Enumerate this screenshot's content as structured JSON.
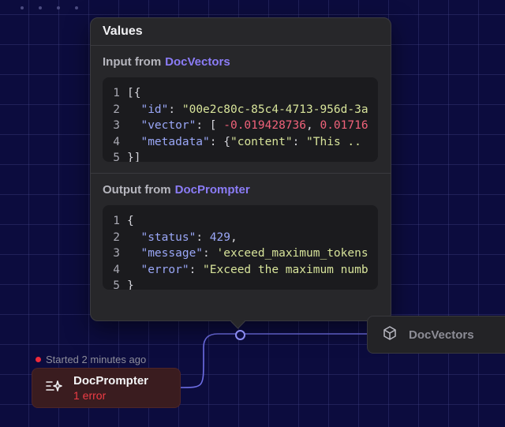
{
  "popover": {
    "title": "Values",
    "input": {
      "prefix": "Input from",
      "source": "DocVectors",
      "lines": [
        {
          "no": "1",
          "parts": [
            {
              "t": "p",
              "v": "[{"
            }
          ]
        },
        {
          "no": "2",
          "parts": [
            {
              "t": "p",
              "v": "  "
            },
            {
              "t": "k",
              "v": "\"id\""
            },
            {
              "t": "p",
              "v": ": "
            },
            {
              "t": "s",
              "v": "\"00e2c80c-85c4-4713-956d-3a"
            }
          ]
        },
        {
          "no": "3",
          "parts": [
            {
              "t": "p",
              "v": "  "
            },
            {
              "t": "k",
              "v": "\"vector\""
            },
            {
              "t": "p",
              "v": ": [ "
            },
            {
              "t": "n",
              "v": "-0.019428736"
            },
            {
              "t": "p",
              "v": ", "
            },
            {
              "t": "n",
              "v": "0.01716"
            }
          ]
        },
        {
          "no": "4",
          "parts": [
            {
              "t": "p",
              "v": "  "
            },
            {
              "t": "k",
              "v": "\"metadata\""
            },
            {
              "t": "p",
              "v": ": {"
            },
            {
              "t": "s",
              "v": "\"content\""
            },
            {
              "t": "p",
              "v": ": "
            },
            {
              "t": "s",
              "v": "\"This .."
            }
          ]
        },
        {
          "no": "5",
          "parts": [
            {
              "t": "p",
              "v": "}]"
            }
          ]
        }
      ]
    },
    "output": {
      "prefix": "Output from",
      "source": "DocPrompter",
      "lines": [
        {
          "no": "1",
          "parts": [
            {
              "t": "p",
              "v": "{"
            }
          ]
        },
        {
          "no": "2",
          "parts": [
            {
              "t": "p",
              "v": "  "
            },
            {
              "t": "k",
              "v": "\"status\""
            },
            {
              "t": "p",
              "v": ": "
            },
            {
              "t": "k",
              "v": "429"
            },
            {
              "t": "p",
              "v": ","
            }
          ]
        },
        {
          "no": "3",
          "parts": [
            {
              "t": "p",
              "v": "  "
            },
            {
              "t": "k",
              "v": "\"message\""
            },
            {
              "t": "p",
              "v": ": "
            },
            {
              "t": "s",
              "v": "'exceed_maximum_tokens"
            }
          ]
        },
        {
          "no": "4",
          "parts": [
            {
              "t": "p",
              "v": "  "
            },
            {
              "t": "k",
              "v": "\"error\""
            },
            {
              "t": "p",
              "v": ": "
            },
            {
              "t": "s",
              "v": "\"Exceed the maximum numb"
            }
          ]
        },
        {
          "no": "5",
          "parts": [
            {
              "t": "p",
              "v": "}"
            }
          ]
        }
      ]
    }
  },
  "nodes": {
    "vectors": {
      "label": "DocVectors",
      "icon": "cube-icon"
    },
    "prompter": {
      "label": "DocPrompter",
      "error": "1 error",
      "icon": "sparkle-list-icon"
    }
  },
  "status": {
    "text": "Started 2 minutes ago"
  },
  "colors": {
    "accent": "#8b7cf6",
    "error": "#ef2a3a",
    "background": "#0c0c3e"
  }
}
